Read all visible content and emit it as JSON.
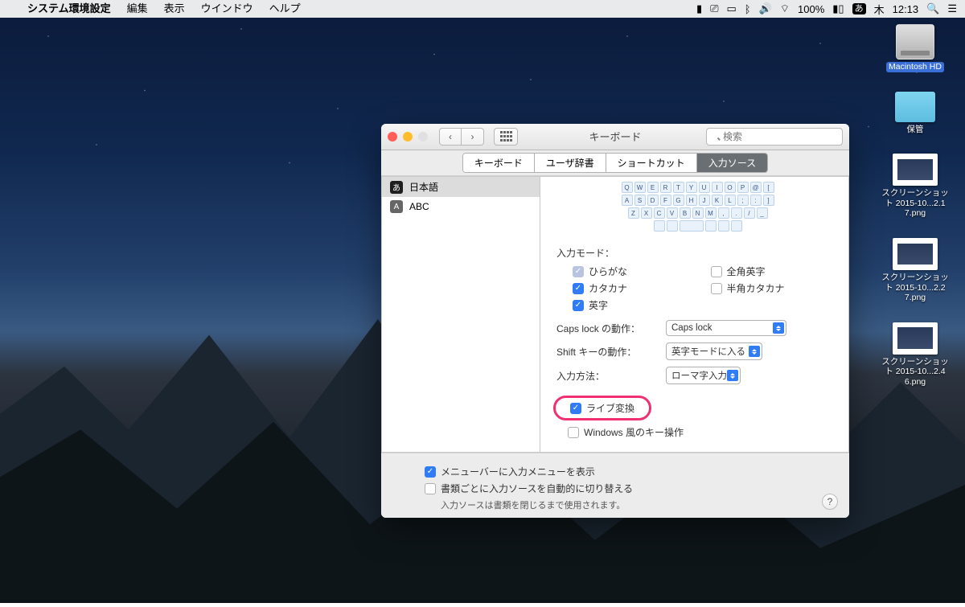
{
  "menubar": {
    "app": "システム環境設定",
    "items": [
      "編集",
      "表示",
      "ウインドウ",
      "ヘルプ"
    ],
    "battery": "100%",
    "ime": "あ",
    "day": "木",
    "time": "12:13"
  },
  "desktop_icons": {
    "hd": "Macintosh HD",
    "folder": "保管",
    "shots": [
      "スクリーンショット 2015-10...2.17.png",
      "スクリーンショット 2015-10...2.27.png",
      "スクリーンショット 2015-10...2.46.png"
    ]
  },
  "window": {
    "title": "キーボード",
    "search_placeholder": "検索",
    "tabs": [
      "キーボード",
      "ユーザ辞書",
      "ショートカット",
      "入力ソース"
    ],
    "active_tab": 3,
    "sources": [
      {
        "icon": "あ",
        "label": "日本語",
        "sel": true
      },
      {
        "icon": "A",
        "label": "ABC",
        "sel": false
      }
    ],
    "kbd_rows": [
      [
        "Q",
        "W",
        "E",
        "R",
        "T",
        "Y",
        "U",
        "I",
        "O",
        "P",
        "@",
        "["
      ],
      [
        "A",
        "S",
        "D",
        "F",
        "G",
        "H",
        "J",
        "K",
        "L",
        ";",
        ":",
        "]"
      ],
      [
        "Z",
        "X",
        "C",
        "V",
        "B",
        "N",
        "M",
        ",",
        ".",
        "/",
        "_"
      ]
    ],
    "settings": {
      "input_mode_label": "入力モード：",
      "modes": [
        {
          "label": "ひらがな",
          "checked": true,
          "disabled": true
        },
        {
          "label": "全角英字",
          "checked": false
        },
        {
          "label": "カタカナ",
          "checked": true
        },
        {
          "label": "半角カタカナ",
          "checked": false
        },
        {
          "label": "英字",
          "checked": true
        }
      ],
      "capslock_label": "Caps lock の動作：",
      "capslock_value": "Caps lock",
      "shift_label": "Shift キーの動作：",
      "shift_value": "英字モードに入る",
      "method_label": "入力方法：",
      "method_value": "ローマ字入力",
      "live_convert": "ライブ変換",
      "windows_keys": "Windows 風のキー操作"
    },
    "footer": {
      "show_menu": "メニューバーに入力メニューを表示",
      "auto_switch": "書類ごとに入力ソースを自動的に切り替える",
      "note": "入力ソースは書類を閉じるまで使用されます。"
    }
  }
}
